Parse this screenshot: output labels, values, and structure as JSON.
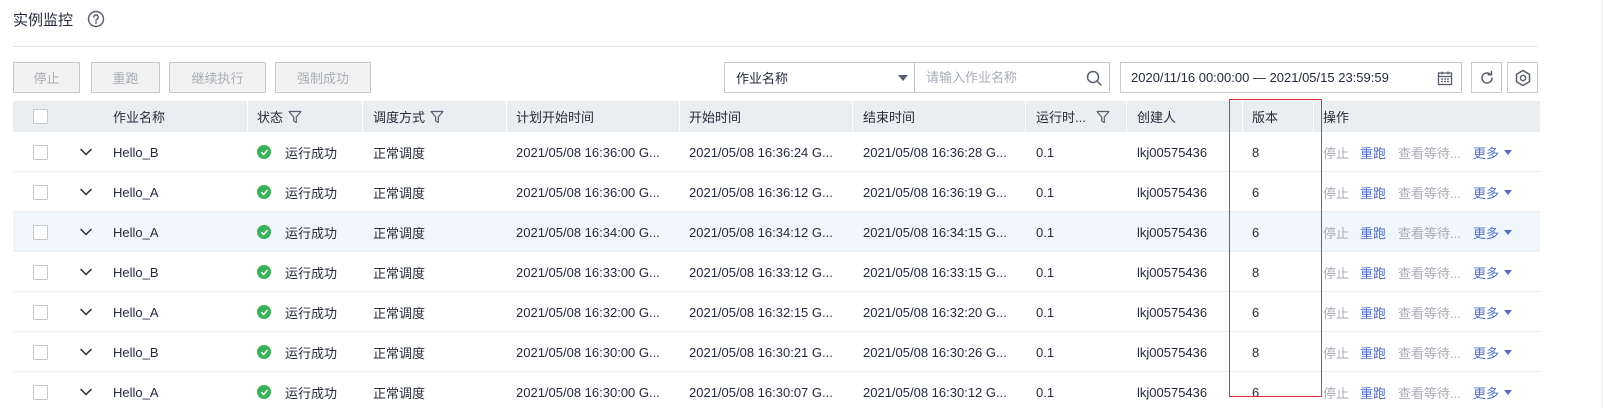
{
  "page": {
    "title": "实例监控"
  },
  "toolbar": {
    "buttons": [
      {
        "label": "停止"
      },
      {
        "label": "重跑"
      },
      {
        "label": "继续执行"
      },
      {
        "label": "强制成功"
      }
    ]
  },
  "filter": {
    "field_selected": "作业名称",
    "search_placeholder": "请输入作业名称",
    "date_range": "2020/11/16 00:00:00 — 2021/05/15 23:59:59"
  },
  "table": {
    "columns": {
      "name": "作业名称",
      "status": "状态",
      "schedule": "调度方式",
      "plan_start": "计划开始时间",
      "start": "开始时间",
      "end": "结束时间",
      "runtime": "运行时...",
      "creator": "创建人",
      "version": "版本",
      "ops": "操作"
    },
    "rows": [
      {
        "name": "Hello_B",
        "status": "运行成功",
        "schedule": "正常调度",
        "plan_start": "2021/05/08 16:36:00 G...",
        "start": "2021/05/08 16:36:24 G...",
        "end": "2021/05/08 16:36:28 G...",
        "runtime": "0.1",
        "creator": "lkj00575436",
        "version": "8"
      },
      {
        "name": "Hello_A",
        "status": "运行成功",
        "schedule": "正常调度",
        "plan_start": "2021/05/08 16:36:00 G...",
        "start": "2021/05/08 16:36:12 G...",
        "end": "2021/05/08 16:36:19 G...",
        "runtime": "0.1",
        "creator": "lkj00575436",
        "version": "6"
      },
      {
        "name": "Hello_A",
        "status": "运行成功",
        "schedule": "正常调度",
        "plan_start": "2021/05/08 16:34:00 G...",
        "start": "2021/05/08 16:34:12 G...",
        "end": "2021/05/08 16:34:15 G...",
        "runtime": "0.1",
        "creator": "lkj00575436",
        "version": "6"
      },
      {
        "name": "Hello_B",
        "status": "运行成功",
        "schedule": "正常调度",
        "plan_start": "2021/05/08 16:33:00 G...",
        "start": "2021/05/08 16:33:12 G...",
        "end": "2021/05/08 16:33:15 G...",
        "runtime": "0.1",
        "creator": "lkj00575436",
        "version": "8"
      },
      {
        "name": "Hello_A",
        "status": "运行成功",
        "schedule": "正常调度",
        "plan_start": "2021/05/08 16:32:00 G...",
        "start": "2021/05/08 16:32:15 G...",
        "end": "2021/05/08 16:32:20 G...",
        "runtime": "0.1",
        "creator": "lkj00575436",
        "version": "6"
      },
      {
        "name": "Hello_B",
        "status": "运行成功",
        "schedule": "正常调度",
        "plan_start": "2021/05/08 16:30:00 G...",
        "start": "2021/05/08 16:30:21 G...",
        "end": "2021/05/08 16:30:26 G...",
        "runtime": "0.1",
        "creator": "lkj00575436",
        "version": "8"
      },
      {
        "name": "Hello_A",
        "status": "运行成功",
        "schedule": "正常调度",
        "plan_start": "2021/05/08 16:30:00 G...",
        "start": "2021/05/08 16:30:07 G...",
        "end": "2021/05/08 16:30:12 G...",
        "runtime": "0.1",
        "creator": "lkj00575436",
        "version": "6"
      }
    ],
    "row_ops": {
      "stop": "停止",
      "rerun": "重跑",
      "view_wait": "查看等待...",
      "more": "更多"
    }
  },
  "colors": {
    "accent": "#526ecc",
    "success": "#3bb15c",
    "highlight_box": "#e0323c"
  },
  "icons": [
    "help-icon",
    "chevron-down-icon",
    "search-icon",
    "calendar-icon",
    "refresh-icon",
    "settings-icon",
    "filter-icon",
    "expand-chevron-icon",
    "check-icon",
    "caret-down-icon"
  ]
}
